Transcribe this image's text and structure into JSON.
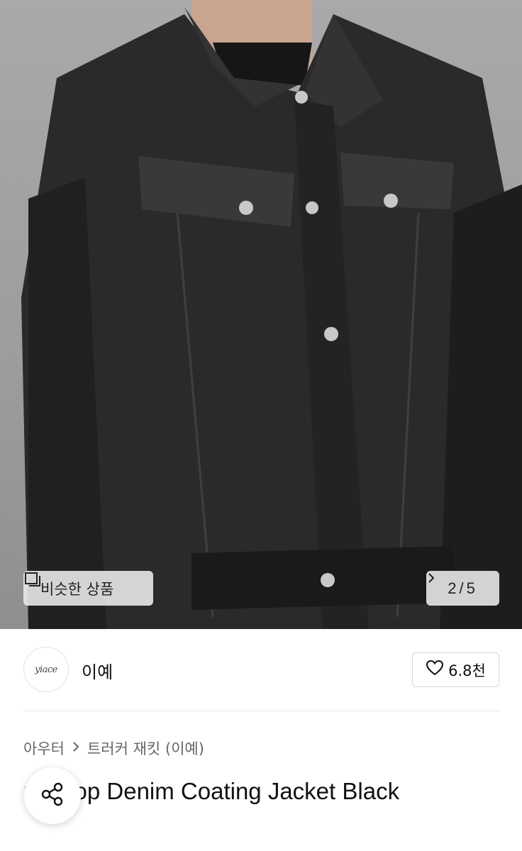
{
  "gallery": {
    "similar_label": "비슷한 상품",
    "page_current": "2",
    "page_separator": " / ",
    "page_total": "5"
  },
  "seller": {
    "logo_text": "yiace",
    "name": "이예",
    "like_count": "6.8천"
  },
  "breadcrumb": {
    "category": "아우터",
    "subcategory": "트러커 재킷 (이예)"
  },
  "product": {
    "title": "nt Crop Denim Coating Jacket Black"
  }
}
